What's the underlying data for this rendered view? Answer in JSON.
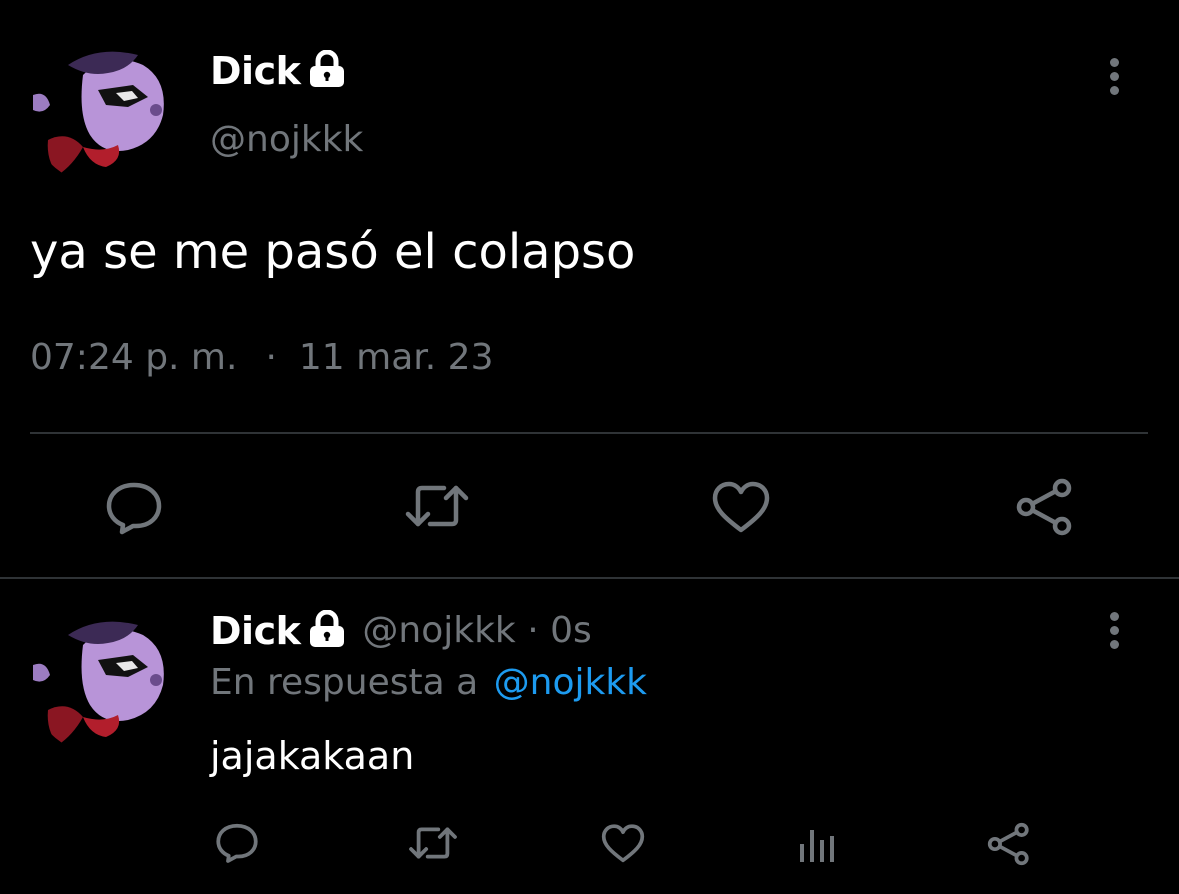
{
  "main_tweet": {
    "author_name": "Dick",
    "handle": "@nojkkk",
    "text": "ya se me pasó el colapso",
    "time": "07:24 p. m.",
    "separator": "·",
    "date": "11 mar. 23",
    "icons": [
      "lock-icon",
      "more-icon",
      "reply-icon",
      "retweet-icon",
      "like-icon",
      "share-icon"
    ]
  },
  "reply_tweet": {
    "author_name": "Dick",
    "handle_time": "@nojkkk · 0s",
    "reply_prefix": "En respuesta a",
    "reply_to": "@nojkkk",
    "text": "jajakakaan",
    "icons": [
      "lock-icon",
      "more-icon",
      "reply-icon",
      "retweet-icon",
      "like-icon",
      "analytics-icon",
      "share-icon"
    ]
  },
  "colors": {
    "background": "#000000",
    "text": "#ffffff",
    "secondary": "#71767b",
    "link": "#1d9bf0",
    "divider": "#2f3336"
  }
}
